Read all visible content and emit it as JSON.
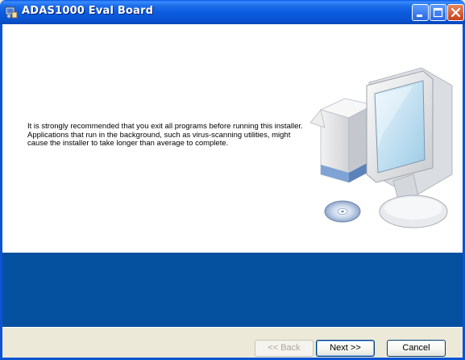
{
  "window": {
    "title": "ADAS1000 Eval Board",
    "app_icon": "installer-icon",
    "controls": [
      "minimize-icon",
      "maximize-icon",
      "close-icon"
    ]
  },
  "content": {
    "message": "It is strongly recommended that you exit all programs before running this installer. Applications that run in the background, such as virus-scanning utilities, might cause the installer to take longer than average to complete.",
    "illustration": "computer-with-software-box-and-cd"
  },
  "footer": {
    "back_label": "<< Back",
    "next_label": "Next >>",
    "cancel_label": "Cancel"
  },
  "colors": {
    "titlebar": "#0A54D4",
    "band": "#0650A0",
    "dialog": "#ECE9D8"
  }
}
